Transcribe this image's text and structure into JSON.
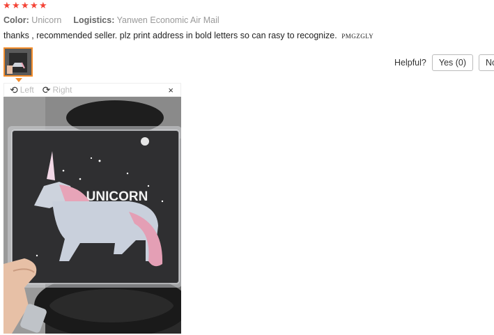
{
  "review": {
    "rating": 5,
    "color_key": "Color:",
    "color_value": "Unicorn",
    "logistics_key": "Logistics:",
    "logistics_value": "Yanwen Economic Air Mail",
    "comment": "thanks , recommended seller. plz print address in bold letters so can rasy to recognize.",
    "comment_tail": "PMGZGLY"
  },
  "helpful": {
    "label": "Helpful?",
    "yes_label": "Yes (0)",
    "no_label": "No"
  },
  "viewer": {
    "left_label": "Left",
    "right_label": "Right",
    "close_label": "×"
  },
  "photo": {
    "package_text": "UNICORN"
  },
  "colors": {
    "star": "#f44336",
    "thumb_border": "#f38d2b"
  }
}
